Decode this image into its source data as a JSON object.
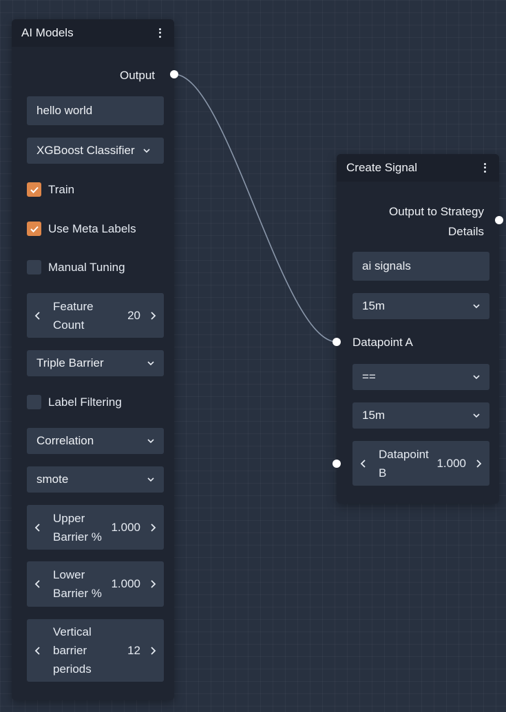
{
  "ai_models": {
    "title": "AI Models",
    "output_label": "Output",
    "name_value": "hello world",
    "model_select": "XGBoost Classifier",
    "train_label": "Train",
    "train_checked": true,
    "meta_labels_label": "Use Meta Labels",
    "meta_labels_checked": true,
    "manual_tuning_label": "Manual Tuning",
    "manual_tuning_checked": false,
    "feature_count_label": "Feature Count",
    "feature_count_value": "20",
    "labeling_select": "Triple Barrier",
    "label_filtering_label": "Label Filtering",
    "label_filtering_checked": false,
    "filter_select": "Correlation",
    "sampling_select": "smote",
    "upper_barrier_label": "Upper Barrier %",
    "upper_barrier_value": "1.000",
    "lower_barrier_label": "Lower Barrier %",
    "lower_barrier_value": "1.000",
    "vertical_barrier_label": "Vertical barrier periods",
    "vertical_barrier_value": "12"
  },
  "create_signal": {
    "title": "Create Signal",
    "output_label": "Output to Strategy Details",
    "name_value": "ai signals",
    "timeframe_a": "15m",
    "datapoint_a_label": "Datapoint A",
    "operator": "==",
    "timeframe_b": "15m",
    "datapoint_b_label": "Datapoint B",
    "datapoint_b_value": "1.000"
  },
  "colors": {
    "canvas": "#283140",
    "node": "#1f2531",
    "field": "#323c4c",
    "checkbox_on": "#e0884a",
    "wire": "#8a97aa"
  }
}
